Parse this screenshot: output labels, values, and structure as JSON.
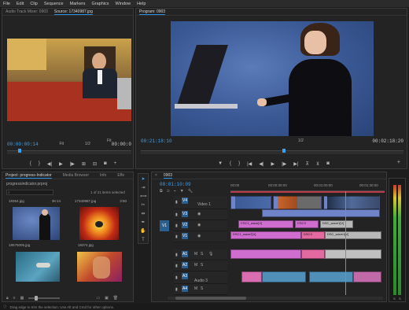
{
  "menu": [
    "File",
    "Edit",
    "Clip",
    "Sequence",
    "Markers",
    "Graphics",
    "Window",
    "Help"
  ],
  "source": {
    "tabs": [
      "Audio Track Mixer: 0903",
      "Source: 17340987.jpg"
    ],
    "timecode_in": "00:00:00:14",
    "fit": "Fit",
    "fraction": "1/2",
    "timecode_out": "00:00:0"
  },
  "program": {
    "tab": "Program: 0903",
    "timecode_in": "00:21:18:10",
    "fit": "Fit",
    "fraction": "1/2",
    "timecode_out": "00:02:18:20"
  },
  "project": {
    "tabs": [
      "Project: progress-Indicator",
      "Media Browser",
      "Info",
      "Effe"
    ],
    "path": "progressindicator.prproj",
    "search_placeholder": "",
    "count": "1 of 21 items selected",
    "items": [
      {
        "name": "18354.jpg",
        "dur": "36:14"
      },
      {
        "name": "17340987.jpg",
        "dur": "3:50"
      },
      {
        "name": "18575005.jpg",
        "dur": ""
      },
      {
        "name": "18374.jpg",
        "dur": ""
      }
    ]
  },
  "timeline": {
    "tab": "0903",
    "timecode": "00:01:10:09",
    "ruler": [
      "00:00",
      "00:00:30:00",
      "00:01:00:00",
      "00:01:30:00"
    ],
    "video_tracks": [
      {
        "id": "V4",
        "label": "Video 1"
      },
      {
        "id": "V3",
        "label": ""
      },
      {
        "id": "V2",
        "label": ""
      },
      {
        "id": "V1",
        "label": ""
      }
    ],
    "audio_tracks": [
      {
        "id": "A1",
        "label": ""
      },
      {
        "id": "A2",
        "label": ""
      },
      {
        "id": "A3",
        "label": "Audio 3"
      },
      {
        "id": "A4",
        "label": ""
      }
    ],
    "clips": {
      "v2a": "CSC1_wave[V]",
      "v2b": "CSC3",
      "v2c": "DSC_wave1[V]",
      "v1a": "DSC1_wave2[V]",
      "v1b": "DSC3",
      "v1c": "DSC_wave1[V]"
    }
  },
  "status": "Drag edge to trim the selection. Use Alt and Cmd for other options."
}
